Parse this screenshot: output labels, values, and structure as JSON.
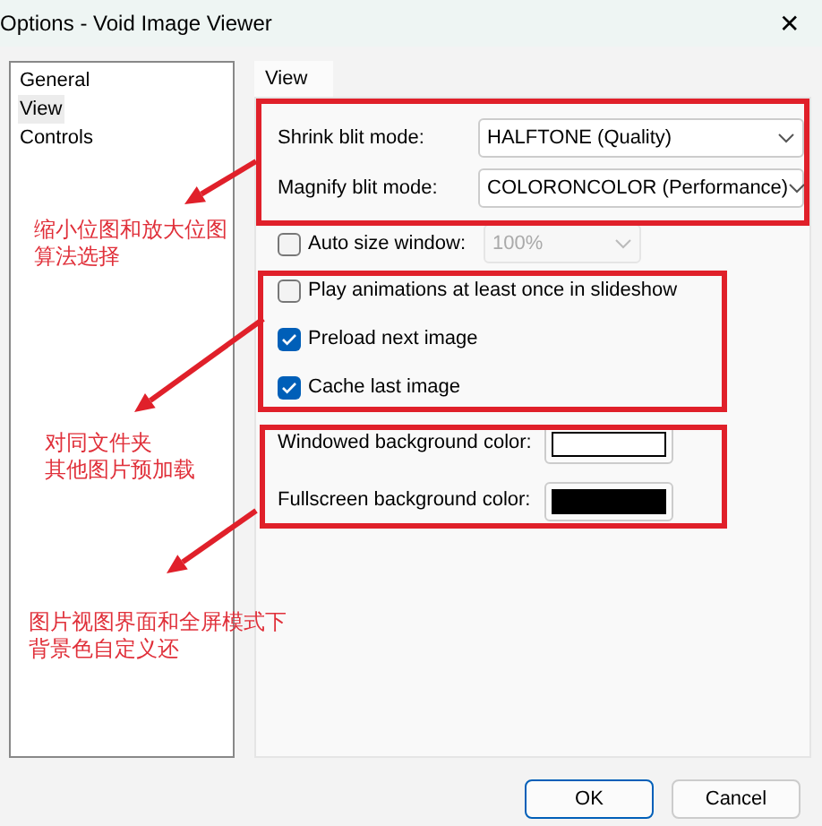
{
  "window": {
    "title": "Options - Void Image Viewer",
    "close": "✕"
  },
  "sidebar": {
    "items": [
      {
        "label": "General",
        "selected": false
      },
      {
        "label": "View",
        "selected": true
      },
      {
        "label": "Controls",
        "selected": false
      }
    ]
  },
  "tabs": [
    {
      "label": "View",
      "selected": true
    }
  ],
  "settings": [
    {
      "kind": "combo",
      "label": "Shrink blit mode:",
      "value": "HALFTONE (Quality)",
      "disabled": false
    },
    {
      "kind": "combo",
      "label": "Magnify blit mode:",
      "value": "COLORONCOLOR (Performance)",
      "disabled": false
    },
    {
      "kind": "checkcombo",
      "label": "Auto size window:",
      "checked": false,
      "value": "100%",
      "disabled": true
    },
    {
      "kind": "check",
      "label": "Play animations at least once in slideshow",
      "checked": false
    },
    {
      "kind": "check",
      "label": "Preload next image",
      "checked": true
    },
    {
      "kind": "check",
      "label": "Cache last image",
      "checked": true
    },
    {
      "kind": "color",
      "label": "Windowed background color:",
      "color": "#ffffff"
    },
    {
      "kind": "color",
      "label": "Fullscreen background color:",
      "color": "#000000"
    }
  ],
  "buttons": [
    {
      "label": "OK",
      "default": true
    },
    {
      "label": "Cancel",
      "default": false
    }
  ],
  "annotations": [
    {
      "lines": [
        "缩小位图和放大位图",
        "算法选择"
      ]
    },
    {
      "lines": [
        "对同文件夹",
        "其他图片预加载"
      ]
    },
    {
      "lines": [
        "图片视图界面和全屏模式下",
        "背景色自定义还"
      ]
    }
  ]
}
